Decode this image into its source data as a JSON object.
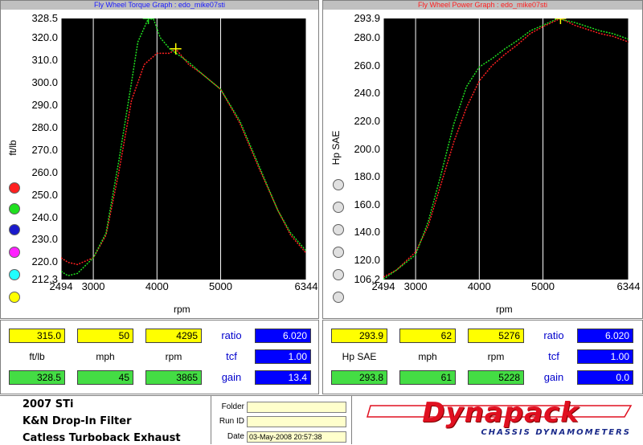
{
  "torque_graph": {
    "title": "Fly Wheel Torque Graph : edo_mike07sti",
    "ylabel": "ft/lb",
    "xlabel": "rpm",
    "y_ticks": [
      "328.5",
      "320.0",
      "310.0",
      "300.0",
      "290.0",
      "280.0",
      "270.0",
      "260.0",
      "250.0",
      "240.0",
      "230.0",
      "220.0",
      "212.3"
    ],
    "x_ticks": [
      "2494",
      "3000",
      "4000",
      "5000",
      "6344"
    ]
  },
  "power_graph": {
    "title": "Fly Wheel Power Graph : edo_mike07sti",
    "ylabel": "Hp SAE",
    "xlabel": "rpm",
    "y_ticks": [
      "293.9",
      "280.0",
      "260.0",
      "240.0",
      "220.0",
      "200.0",
      "180.0",
      "160.0",
      "140.0",
      "120.0",
      "106.2"
    ],
    "x_ticks": [
      "2494",
      "3000",
      "4000",
      "5000",
      "6344"
    ]
  },
  "torque_readout": {
    "cursor": {
      "value": "315.0",
      "mph": "50",
      "rpm": "4295"
    },
    "labels": {
      "unit": "ft/lb",
      "mph": "mph",
      "rpm": "rpm"
    },
    "peak": {
      "value": "328.5",
      "mph": "45",
      "rpm": "3865"
    },
    "ratio_label": "ratio",
    "ratio": "6.020",
    "tcf_label": "tcf",
    "tcf": "1.00",
    "gain_label": "gain",
    "gain": "13.4"
  },
  "power_readout": {
    "cursor": {
      "value": "293.9",
      "mph": "62",
      "rpm": "5276"
    },
    "labels": {
      "unit": "Hp SAE",
      "mph": "mph",
      "rpm": "rpm"
    },
    "peak": {
      "value": "293.8",
      "mph": "61",
      "rpm": "5228"
    },
    "ratio_label": "ratio",
    "ratio": "6.020",
    "tcf_label": "tcf",
    "tcf": "1.00",
    "gain_label": "gain",
    "gain": "0.0"
  },
  "series_colors": {
    "red": "#ff2020",
    "green": "#20e020",
    "blue": "#1a1acc",
    "magenta": "#ff20ff",
    "cyan": "#20ffff",
    "yellow": "#ffff00"
  },
  "run_info": {
    "line1": "2007 STi",
    "line2": "K&N Drop-In Filter",
    "line3": "Catless Turboback Exhaust",
    "folder_label": "Folder",
    "folder_value": "",
    "runid_label": "Run ID",
    "runid_value": "",
    "date_label": "Date",
    "date_value": "03-May-2008  20:57:38"
  },
  "brand": {
    "name": "Dynapack",
    "tagline": "CHASSIS DYNAMOMETERS",
    "color": "#e01020"
  },
  "chart_data": [
    {
      "type": "line",
      "title": "Fly Wheel Torque Graph : edo_mike07sti",
      "xlabel": "rpm",
      "ylabel": "ft/lb",
      "xlim": [
        2494,
        6344
      ],
      "ylim": [
        212.3,
        328.5
      ],
      "series": [
        {
          "color": "red",
          "x": [
            2494,
            2600,
            2750,
            3000,
            3200,
            3400,
            3600,
            3800,
            4000,
            4200,
            4295,
            4500,
            4700,
            5000,
            5300,
            5600,
            5900,
            6100,
            6344
          ],
          "y": [
            222,
            220,
            219,
            222,
            232,
            260,
            292,
            308,
            313,
            313,
            315,
            308,
            304,
            297,
            282,
            262,
            243,
            232,
            224
          ]
        },
        {
          "color": "green",
          "x": [
            2494,
            2600,
            2750,
            3000,
            3200,
            3400,
            3600,
            3700,
            3865,
            3950,
            4050,
            4200,
            4500,
            4700,
            5000,
            5300,
            5600,
            5900,
            6100,
            6344
          ],
          "y": [
            216,
            214,
            215,
            222,
            233,
            265,
            300,
            318,
            328.5,
            328,
            320,
            315,
            309,
            304,
            297,
            283,
            263,
            243,
            233,
            225
          ]
        }
      ]
    },
    {
      "type": "line",
      "title": "Fly Wheel Power Graph : edo_mike07sti",
      "xlabel": "rpm",
      "ylabel": "Hp SAE",
      "xlim": [
        2494,
        6344
      ],
      "ylim": [
        106.2,
        293.9
      ],
      "series": [
        {
          "color": "red",
          "x": [
            2494,
            2700,
            3000,
            3200,
            3400,
            3600,
            3800,
            4000,
            4200,
            4400,
            4600,
            4800,
            5000,
            5276,
            5500,
            5700,
            5900,
            6100,
            6344
          ],
          "y": [
            108,
            113,
            126,
            145,
            175,
            205,
            230,
            249,
            260,
            268,
            275,
            283,
            288,
            293.9,
            289,
            286,
            283,
            281,
            277
          ]
        },
        {
          "color": "green",
          "x": [
            2494,
            2700,
            3000,
            3200,
            3400,
            3600,
            3800,
            4000,
            4200,
            4400,
            4600,
            4800,
            5000,
            5228,
            5500,
            5700,
            5900,
            6100,
            6344
          ],
          "y": [
            106.5,
            113,
            124,
            148,
            182,
            218,
            245,
            259,
            265,
            272,
            278,
            285,
            289,
            293.8,
            291,
            288,
            285,
            283,
            279
          ]
        }
      ]
    }
  ]
}
